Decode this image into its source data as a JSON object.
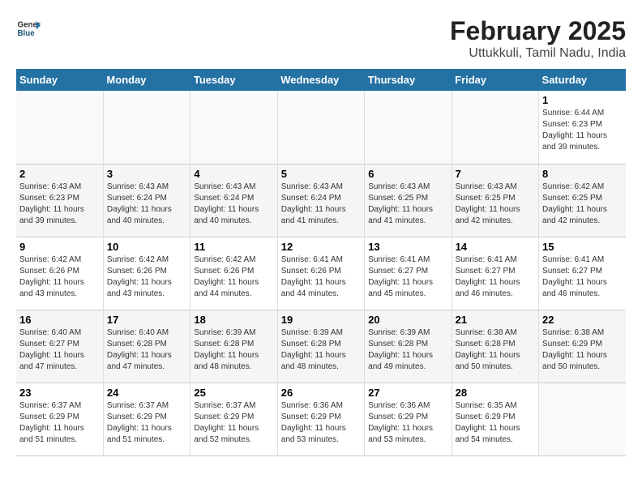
{
  "logo": {
    "general": "General",
    "blue": "Blue"
  },
  "title": "February 2025",
  "subtitle": "Uttukkuli, Tamil Nadu, India",
  "days_of_week": [
    "Sunday",
    "Monday",
    "Tuesday",
    "Wednesday",
    "Thursday",
    "Friday",
    "Saturday"
  ],
  "weeks": [
    [
      {
        "day": "",
        "info": ""
      },
      {
        "day": "",
        "info": ""
      },
      {
        "day": "",
        "info": ""
      },
      {
        "day": "",
        "info": ""
      },
      {
        "day": "",
        "info": ""
      },
      {
        "day": "",
        "info": ""
      },
      {
        "day": "1",
        "info": "Sunrise: 6:44 AM\nSunset: 6:23 PM\nDaylight: 11 hours and 39 minutes."
      }
    ],
    [
      {
        "day": "2",
        "info": "Sunrise: 6:43 AM\nSunset: 6:23 PM\nDaylight: 11 hours and 39 minutes."
      },
      {
        "day": "3",
        "info": "Sunrise: 6:43 AM\nSunset: 6:24 PM\nDaylight: 11 hours and 40 minutes."
      },
      {
        "day": "4",
        "info": "Sunrise: 6:43 AM\nSunset: 6:24 PM\nDaylight: 11 hours and 40 minutes."
      },
      {
        "day": "5",
        "info": "Sunrise: 6:43 AM\nSunset: 6:24 PM\nDaylight: 11 hours and 41 minutes."
      },
      {
        "day": "6",
        "info": "Sunrise: 6:43 AM\nSunset: 6:25 PM\nDaylight: 11 hours and 41 minutes."
      },
      {
        "day": "7",
        "info": "Sunrise: 6:43 AM\nSunset: 6:25 PM\nDaylight: 11 hours and 42 minutes."
      },
      {
        "day": "8",
        "info": "Sunrise: 6:42 AM\nSunset: 6:25 PM\nDaylight: 11 hours and 42 minutes."
      }
    ],
    [
      {
        "day": "9",
        "info": "Sunrise: 6:42 AM\nSunset: 6:26 PM\nDaylight: 11 hours and 43 minutes."
      },
      {
        "day": "10",
        "info": "Sunrise: 6:42 AM\nSunset: 6:26 PM\nDaylight: 11 hours and 43 minutes."
      },
      {
        "day": "11",
        "info": "Sunrise: 6:42 AM\nSunset: 6:26 PM\nDaylight: 11 hours and 44 minutes."
      },
      {
        "day": "12",
        "info": "Sunrise: 6:41 AM\nSunset: 6:26 PM\nDaylight: 11 hours and 44 minutes."
      },
      {
        "day": "13",
        "info": "Sunrise: 6:41 AM\nSunset: 6:27 PM\nDaylight: 11 hours and 45 minutes."
      },
      {
        "day": "14",
        "info": "Sunrise: 6:41 AM\nSunset: 6:27 PM\nDaylight: 11 hours and 46 minutes."
      },
      {
        "day": "15",
        "info": "Sunrise: 6:41 AM\nSunset: 6:27 PM\nDaylight: 11 hours and 46 minutes."
      }
    ],
    [
      {
        "day": "16",
        "info": "Sunrise: 6:40 AM\nSunset: 6:27 PM\nDaylight: 11 hours and 47 minutes."
      },
      {
        "day": "17",
        "info": "Sunrise: 6:40 AM\nSunset: 6:28 PM\nDaylight: 11 hours and 47 minutes."
      },
      {
        "day": "18",
        "info": "Sunrise: 6:39 AM\nSunset: 6:28 PM\nDaylight: 11 hours and 48 minutes."
      },
      {
        "day": "19",
        "info": "Sunrise: 6:39 AM\nSunset: 6:28 PM\nDaylight: 11 hours and 48 minutes."
      },
      {
        "day": "20",
        "info": "Sunrise: 6:39 AM\nSunset: 6:28 PM\nDaylight: 11 hours and 49 minutes."
      },
      {
        "day": "21",
        "info": "Sunrise: 6:38 AM\nSunset: 6:28 PM\nDaylight: 11 hours and 50 minutes."
      },
      {
        "day": "22",
        "info": "Sunrise: 6:38 AM\nSunset: 6:29 PM\nDaylight: 11 hours and 50 minutes."
      }
    ],
    [
      {
        "day": "23",
        "info": "Sunrise: 6:37 AM\nSunset: 6:29 PM\nDaylight: 11 hours and 51 minutes."
      },
      {
        "day": "24",
        "info": "Sunrise: 6:37 AM\nSunset: 6:29 PM\nDaylight: 11 hours and 51 minutes."
      },
      {
        "day": "25",
        "info": "Sunrise: 6:37 AM\nSunset: 6:29 PM\nDaylight: 11 hours and 52 minutes."
      },
      {
        "day": "26",
        "info": "Sunrise: 6:36 AM\nSunset: 6:29 PM\nDaylight: 11 hours and 53 minutes."
      },
      {
        "day": "27",
        "info": "Sunrise: 6:36 AM\nSunset: 6:29 PM\nDaylight: 11 hours and 53 minutes."
      },
      {
        "day": "28",
        "info": "Sunrise: 6:35 AM\nSunset: 6:29 PM\nDaylight: 11 hours and 54 minutes."
      },
      {
        "day": "",
        "info": ""
      }
    ]
  ]
}
